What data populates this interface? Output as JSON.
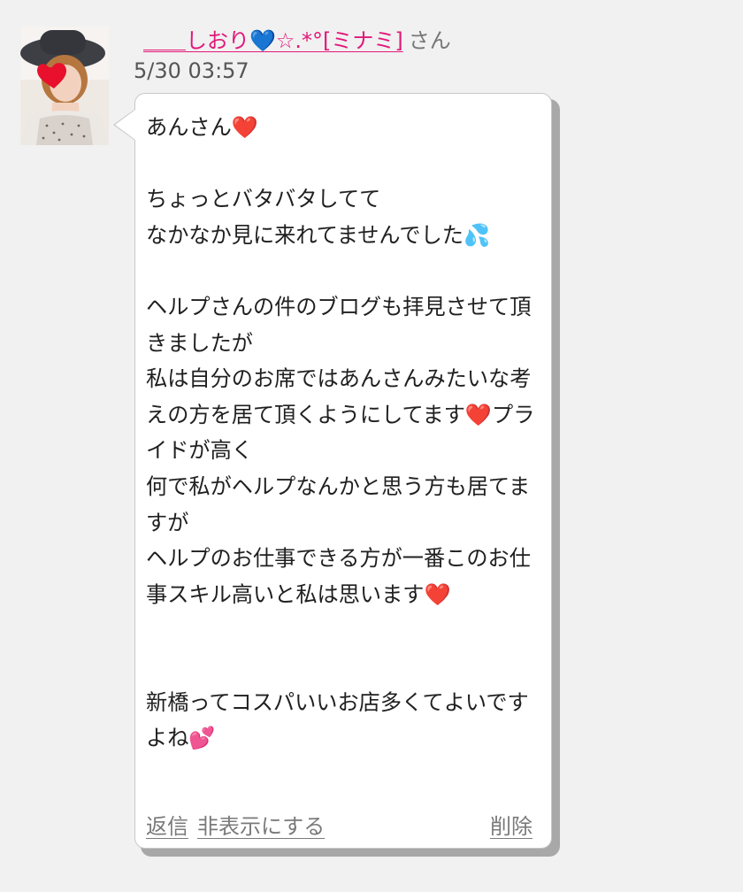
{
  "sender": {
    "name": "＿＿しおり💙☆.*°[ミナミ]",
    "suffix": "さん",
    "avatar_icon": "profile-photo-woman-in-hat"
  },
  "message": {
    "timestamp": "5/30 03:57",
    "greeting": "あんさん",
    "line_1": "ちょっとバタバタしてて",
    "line_2": "なかなか見に来れてませんでした",
    "para_a": "ヘルプさんの件のブログも拝見させて頂きましたが\n私は自分のお席ではあんさんみたいな考えの方を居て頂くようにしてます",
    "para_b": "プライドが高く\n何で私がヘルプなんかと思う方も居てますが\nヘルプのお仕事できる方が一番このお仕事スキル高いと私は思います",
    "line_3": "新橋ってコスパいいお店多くてよいですよね",
    "emoji": {
      "heart": "❤️",
      "droplets": "💦",
      "two_hearts": "💕"
    }
  },
  "actions": {
    "reply": "返信",
    "hide": "非表示にする",
    "delete": "削除"
  },
  "colors": {
    "background": "#f1f1f1",
    "sender_name": "#e2187a",
    "link_gray": "#7a7a7a"
  }
}
